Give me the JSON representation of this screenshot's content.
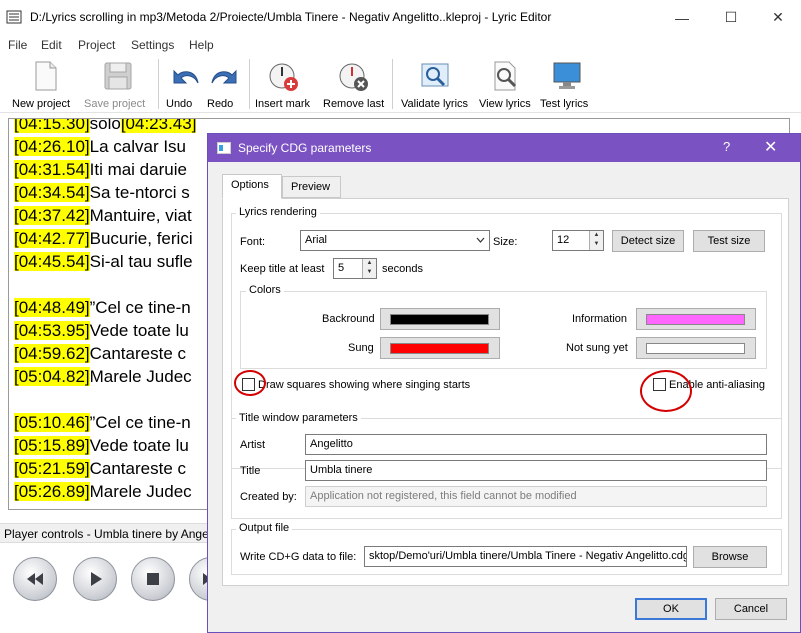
{
  "window": {
    "title": "D:/Lyrics scrolling in mp3/Metoda 2/Proiecte/Umbla Tinere - Negativ Angelitto..kleproj - Lyric Editor"
  },
  "menu": [
    "File",
    "Edit",
    "Project",
    "Settings",
    "Help"
  ],
  "toolbar": {
    "new_project": "New project",
    "save_project": "Save project",
    "undo": "Undo",
    "redo": "Redo",
    "insert_mark": "Insert mark",
    "remove_last": "Remove last",
    "validate_lyrics": "Validate lyrics",
    "view_lyrics": "View lyrics",
    "test_lyrics": "Test lyrics"
  },
  "lyrics": [
    {
      "time": "[04:15.30]",
      "text": "solo",
      "end": "[04:23.43]"
    },
    {
      "time": "[04:26.10]",
      "text": "La calvar Isu"
    },
    {
      "time": "[04:31.54]",
      "text": "Iti mai daruie"
    },
    {
      "time": "[04:34.54]",
      "text": "Sa te-ntorci s"
    },
    {
      "time": "[04:37.42]",
      "text": "Mantuire, viat"
    },
    {
      "time": "[04:42.77]",
      "text": "Bucurie, ferici"
    },
    {
      "time": "[04:45.54]",
      "text": "Si-al tau sufle"
    },
    {
      "time": "[04:48.49]",
      "text": "”Cel ce tine-n"
    },
    {
      "time": "[04:53.95]",
      "text": "Vede toate lu"
    },
    {
      "time": "[04:59.62]",
      "text": "Cantareste c"
    },
    {
      "time": "[05:04.82]",
      "text": "Marele Judec"
    },
    {
      "time": "[05:10.46]",
      "text": "”Cel ce tine-n"
    },
    {
      "time": "[05:15.89]",
      "text": "Vede toate lu"
    },
    {
      "time": "[05:21.59]",
      "text": "Cantareste c"
    },
    {
      "time": "[05:26.89]",
      "text": "Marele Judec"
    }
  ],
  "player": {
    "label": "Player controls - Umbla tinere by Angelitto"
  },
  "dialog": {
    "title": "Specify CDG parameters",
    "help": "?",
    "tabs": [
      "Options",
      "Preview"
    ],
    "lyrics_rendering": {
      "group_label": "Lyrics rendering",
      "font_label": "Font:",
      "font_value": "Arial",
      "size_label": "Size:",
      "size_value": "12",
      "detect_size": "Detect size",
      "test_size": "Test size",
      "keep_title_label": "Keep title at least",
      "keep_title_value": "5",
      "seconds_label": "seconds"
    },
    "colors": {
      "group_label": "Colors",
      "backround_label": "Backround",
      "sung_label": "Sung",
      "information_label": "Information",
      "not_sung_label": "Not sung yet",
      "backround_color": "#000000",
      "sung_color": "#ff0000",
      "information_color": "#ff66ff",
      "not_sung_color": "#ffffff"
    },
    "draw_squares_label": "Draw squares showing where singing starts",
    "anti_aliasing_label": "Enable anti-aliasing",
    "title_window": {
      "group_label": "Title window parameters",
      "artist_label": "Artist",
      "artist_value": "Angelitto",
      "title_label": "Title",
      "title_value": "Umbla tinere",
      "created_label": "Created by:",
      "created_value": "Application not registered, this field cannot be modified"
    },
    "output": {
      "group_label": "Output file",
      "write_label": "Write CD+G data to file:",
      "path_value": "sktop/Demo'uri/Umbla tinere/Umbla Tinere - Negativ Angelitto.cdg",
      "browse": "Browse"
    },
    "ok": "OK",
    "cancel": "Cancel"
  }
}
